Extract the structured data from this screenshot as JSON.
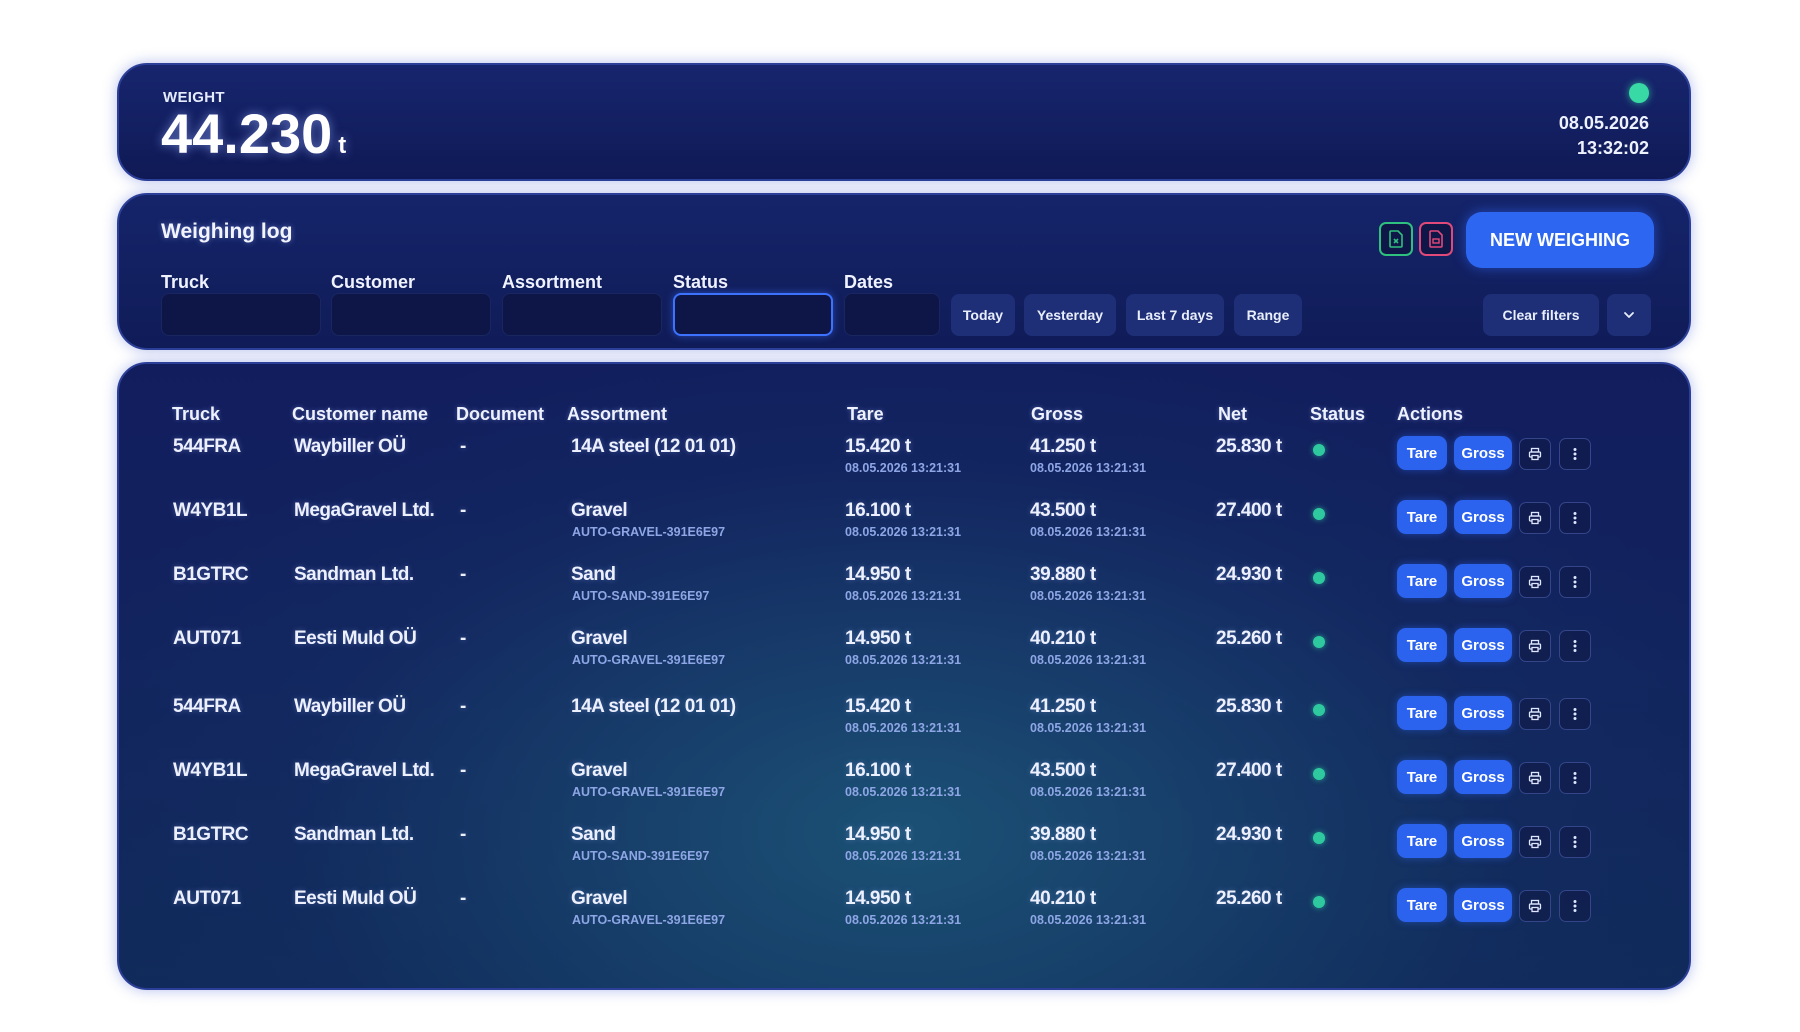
{
  "header": {
    "weight_label": "WEIGHT",
    "weight_value": "44.230",
    "weight_unit": "t",
    "date": "08.05.2026",
    "time": "13:32:02",
    "status_color": "#39d9a6"
  },
  "log": {
    "title": "Weighing log",
    "export_excel_icon": "spreadsheet-file-icon",
    "export_pdf_icon": "pdf-file-icon",
    "new_button": "NEW WEIGHING",
    "filters": {
      "truck_label": "Truck",
      "customer_label": "Customer",
      "assortment_label": "Assortment",
      "status_label": "Status",
      "dates_label": "Dates",
      "truck_value": "",
      "customer_value": "",
      "assortment_value": "",
      "status_value": "",
      "dates_value": ""
    },
    "quick_dates": [
      "Today",
      "Yesterday",
      "Last 7 days",
      "Range"
    ],
    "clear_filters": "Clear filters",
    "accent_color": "#2d66f1"
  },
  "table": {
    "headers": [
      "Truck",
      "Customer name",
      "Document",
      "Assortment",
      "Tare",
      "Gross",
      "Net",
      "Status",
      "Actions"
    ],
    "tare_button": "Tare",
    "gross_button": "Gross",
    "print_icon": "printer-icon",
    "more_icon": "more-vertical-icon",
    "rows": [
      {
        "truck": "544FRA",
        "customer": "Waybiller OÜ",
        "document": "-",
        "assortment": "14A steel (12 01 01)",
        "assortment_code": "",
        "tare": "15.420 t",
        "tare_time": "08.05.2026 13:21:31",
        "gross": "41.250 t",
        "gross_time": "08.05.2026 13:21:31",
        "net": "25.830 t",
        "status": "ok"
      },
      {
        "truck": "W4YB1L",
        "customer": "MegaGravel Ltd.",
        "document": "-",
        "assortment": "Gravel",
        "assortment_code": "AUTO-GRAVEL-391E6E97",
        "tare": "16.100 t",
        "tare_time": "08.05.2026 13:21:31",
        "gross": "43.500 t",
        "gross_time": "08.05.2026 13:21:31",
        "net": "27.400 t",
        "status": "ok"
      },
      {
        "truck": "B1GTRC",
        "customer": "Sandman Ltd.",
        "document": "-",
        "assortment": "Sand",
        "assortment_code": "AUTO-SAND-391E6E97",
        "tare": "14.950 t",
        "tare_time": "08.05.2026 13:21:31",
        "gross": "39.880 t",
        "gross_time": "08.05.2026 13:21:31",
        "net": "24.930 t",
        "status": "ok"
      },
      {
        "truck": "AUT071",
        "customer": "Eesti Muld OÜ",
        "document": "-",
        "assortment": "Gravel",
        "assortment_code": "AUTO-GRAVEL-391E6E97",
        "tare": "14.950 t",
        "tare_time": "08.05.2026 13:21:31",
        "gross": "40.210 t",
        "gross_time": "08.05.2026 13:21:31",
        "net": "25.260 t",
        "status": "ok"
      },
      {
        "truck": "544FRA",
        "customer": "Waybiller OÜ",
        "document": "-",
        "assortment": "14A steel (12 01 01)",
        "assortment_code": "",
        "tare": "15.420 t",
        "tare_time": "08.05.2026 13:21:31",
        "gross": "41.250 t",
        "gross_time": "08.05.2026 13:21:31",
        "net": "25.830 t",
        "status": "ok"
      },
      {
        "truck": "W4YB1L",
        "customer": "MegaGravel Ltd.",
        "document": "-",
        "assortment": "Gravel",
        "assortment_code": "AUTO-GRAVEL-391E6E97",
        "tare": "16.100 t",
        "tare_time": "08.05.2026 13:21:31",
        "gross": "43.500 t",
        "gross_time": "08.05.2026 13:21:31",
        "net": "27.400 t",
        "status": "ok"
      },
      {
        "truck": "B1GTRC",
        "customer": "Sandman Ltd.",
        "document": "-",
        "assortment": "Sand",
        "assortment_code": "AUTO-SAND-391E6E97",
        "tare": "14.950 t",
        "tare_time": "08.05.2026 13:21:31",
        "gross": "39.880 t",
        "gross_time": "08.05.2026 13:21:31",
        "net": "24.930 t",
        "status": "ok"
      },
      {
        "truck": "AUT071",
        "customer": "Eesti Muld OÜ",
        "document": "-",
        "assortment": "Gravel",
        "assortment_code": "AUTO-GRAVEL-391E6E97",
        "tare": "14.950 t",
        "tare_time": "08.05.2026 13:21:31",
        "gross": "40.210 t",
        "gross_time": "08.05.2026 13:21:31",
        "net": "25.260 t",
        "status": "ok"
      }
    ]
  }
}
